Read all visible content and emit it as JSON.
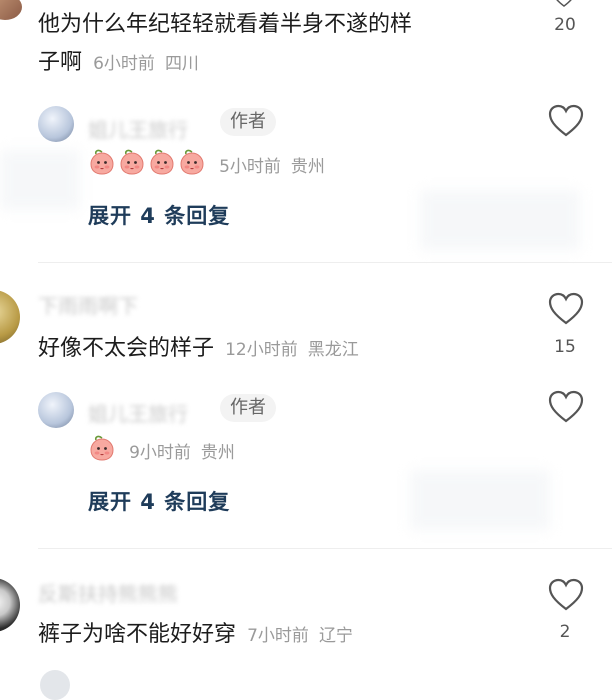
{
  "comments": [
    {
      "id": "c1",
      "text_line1": "他为什么年纪轻轻就看着半身不遂的样",
      "text_line2": "子啊",
      "time": "6小时前",
      "location": "四川",
      "likes": "20",
      "reply": {
        "username": "姐儿王旅行",
        "badge": "作者",
        "time": "5小时前",
        "location": "贵州",
        "emoji_count": 4
      },
      "expand_label": "展开 4 条回复"
    },
    {
      "id": "c2",
      "username": "下雨雨啊下",
      "text": "好像不太会的样子",
      "time": "12小时前",
      "location": "黑龙江",
      "likes": "15",
      "reply": {
        "username": "姐儿王旅行",
        "badge": "作者",
        "time": "9小时前",
        "location": "贵州",
        "emoji_count": 1
      },
      "expand_label": "展开 4 条回复"
    },
    {
      "id": "c3",
      "username": "反斯扶持熊熊熊",
      "text": "裤子为啥不能好好穿",
      "time": "7小时前",
      "location": "辽宁",
      "likes": "2"
    }
  ],
  "icons": {
    "like": "heart-outline-icon",
    "emoji": "peach-face-emoji-icon"
  },
  "colors": {
    "expand_text": "#1f3c5a",
    "meta_text": "#9a9a9a",
    "divider": "#eeeeee"
  }
}
